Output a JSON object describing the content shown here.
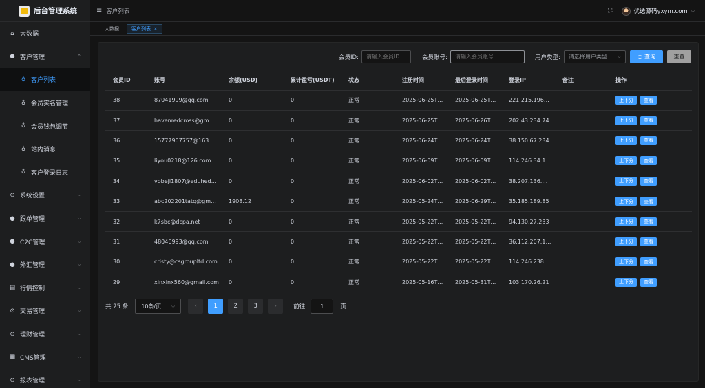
{
  "app": {
    "title": "后台管理系统"
  },
  "header": {
    "breadcrumb": "客户列表",
    "username": "优选源码yxym.com"
  },
  "tags": [
    {
      "label": "大数据"
    },
    {
      "label": "客户列表",
      "close": "×"
    }
  ],
  "sidebar": {
    "items": [
      {
        "label": "大数据",
        "icon": "home-icon",
        "glyph": "⌂"
      },
      {
        "label": "客户管理",
        "icon": "users-icon",
        "glyph": "●",
        "expanded": true
      },
      {
        "label": "客户列表",
        "icon": "thumb-icon",
        "glyph": "♁",
        "active": true
      },
      {
        "label": "会员实名管理",
        "icon": "thumb-icon",
        "glyph": "♁"
      },
      {
        "label": "会员钱包调节",
        "icon": "thumb-icon",
        "glyph": "♁"
      },
      {
        "label": "站内消息",
        "icon": "thumb-icon",
        "glyph": "♁"
      },
      {
        "label": "客户登录日志",
        "icon": "thumb-icon",
        "glyph": "♁"
      },
      {
        "label": "系统设置",
        "icon": "settings-icon",
        "glyph": "⊙"
      },
      {
        "label": "跟单管理",
        "icon": "copy-trade-icon",
        "glyph": "●"
      },
      {
        "label": "C2C管理",
        "icon": "c2c-icon",
        "glyph": "●"
      },
      {
        "label": "外汇管理",
        "icon": "forex-icon",
        "glyph": "●"
      },
      {
        "label": "行情控制",
        "icon": "chart-icon",
        "glyph": "▤"
      },
      {
        "label": "交易管理",
        "icon": "trade-icon",
        "glyph": "⊙"
      },
      {
        "label": "理财管理",
        "icon": "finance-icon",
        "glyph": "⊙"
      },
      {
        "label": "CMS管理",
        "icon": "cms-icon",
        "glyph": "▦"
      },
      {
        "label": "报表管理",
        "icon": "report-icon",
        "glyph": "⊙"
      }
    ]
  },
  "filter": {
    "member_id_label": "会员ID:",
    "member_id_placeholder": "请输入会员ID",
    "account_label": "会员账号:",
    "account_placeholder": "请输入会员账号",
    "user_type_label": "用户类型:",
    "user_type_placeholder": "请选择用户类型",
    "query_label": "查询",
    "reset_label": "重置"
  },
  "table": {
    "columns": [
      "会员ID",
      "账号",
      "余额(USD)",
      "累计盈亏(USDT)",
      "状态",
      "注册时间",
      "最后登录时间",
      "登录IP",
      "备注",
      "操作"
    ],
    "op_labels": [
      "上下分",
      "查看"
    ],
    "rows": [
      [
        "38",
        "87041999@qq.com",
        "0",
        "0",
        "正常",
        "2025-06-25T…",
        "2025-06-25T…",
        "221.215.196…",
        ""
      ],
      [
        "37",
        "havenredcross@gm…",
        "0",
        "0",
        "正常",
        "2025-06-25T…",
        "2025-06-26T…",
        "202.43.234.74",
        ""
      ],
      [
        "36",
        "15777907757@163.…",
        "0",
        "0",
        "正常",
        "2025-06-24T…",
        "2025-06-24T…",
        "38.150.67.234",
        ""
      ],
      [
        "35",
        "liyou0218@126.com",
        "0",
        "0",
        "正常",
        "2025-06-09T…",
        "2025-06-09T…",
        "114.246.34.1…",
        ""
      ],
      [
        "34",
        "vobeji1807@eduhed…",
        "0",
        "0",
        "正常",
        "2025-06-02T…",
        "2025-06-02T…",
        "38.207.136.…",
        ""
      ],
      [
        "33",
        "abc202201tatq@gm…",
        "1908.12",
        "0",
        "正常",
        "2025-05-24T…",
        "2025-06-29T…",
        "35.185.189.85",
        ""
      ],
      [
        "32",
        "k7sbc@dcpa.net",
        "0",
        "0",
        "正常",
        "2025-05-22T…",
        "2025-05-22T…",
        "94.130.27.233",
        ""
      ],
      [
        "31",
        "48046993@qq.com",
        "0",
        "0",
        "正常",
        "2025-05-22T…",
        "2025-05-22T…",
        "36.112.207.1…",
        ""
      ],
      [
        "30",
        "cristy@csgroupltd.com",
        "0",
        "0",
        "正常",
        "2025-05-22T…",
        "2025-05-22T…",
        "114.246.238.…",
        ""
      ],
      [
        "29",
        "xinxinx560@gmail.com",
        "0",
        "0",
        "正常",
        "2025-05-16T…",
        "2025-05-31T…",
        "103.170.26.21",
        ""
      ]
    ]
  },
  "pagination": {
    "total": "共 25 条",
    "page_size": "10条/页",
    "pages": [
      "1",
      "2",
      "3"
    ],
    "current": "1",
    "prev": "‹",
    "next": "›",
    "goto_label": "前往",
    "goto_value": "1",
    "page_unit": "页"
  },
  "colors": {
    "accent": "#409eff",
    "background": "#141414",
    "panel": "#1d1e1f"
  }
}
